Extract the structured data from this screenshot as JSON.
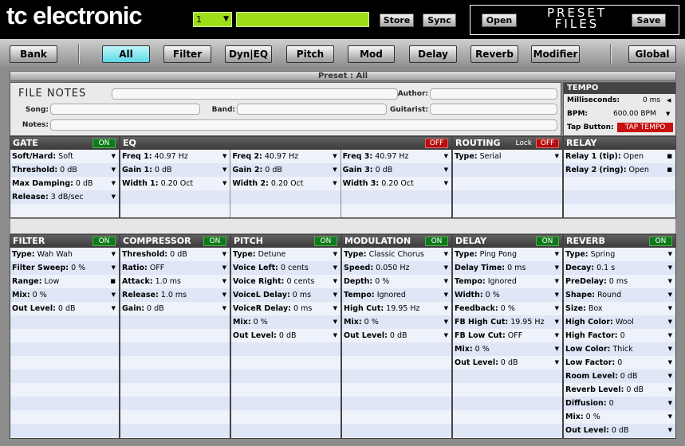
{
  "brand": {
    "name": "tc electronic"
  },
  "top": {
    "preset_number": "1",
    "store": "Store",
    "sync": "Sync",
    "open": "Open",
    "save": "Save",
    "preset_files_line1": "PRESET",
    "preset_files_line2": "FILES"
  },
  "nav": {
    "items": [
      "Bank",
      "All",
      "Filter",
      "Dyn|EQ",
      "Pitch",
      "Mod",
      "Delay",
      "Reverb",
      "Modifier",
      "Global"
    ],
    "active": "All"
  },
  "preset_bar": "Preset : All",
  "notes": {
    "title": "FILE NOTES",
    "song": "Song:",
    "band": "Band:",
    "author": "Author:",
    "guitarist": "Guitarist:",
    "notes": "Notes:"
  },
  "tempo": {
    "title": "TEMPO",
    "ms_label": "Milliseconds:",
    "ms_value": "0 ms",
    "bpm_label": "BPM:",
    "bpm_value": "600.00 BPM",
    "tap_label": "Tap Button:",
    "tap_value": "TAP TEMPO"
  },
  "gate": {
    "title": "GATE",
    "state": "ON",
    "rows": [
      [
        "Soft/Hard:",
        "Soft"
      ],
      [
        "Threshold:",
        "0 dB"
      ],
      [
        "Max Damping:",
        "0 dB"
      ],
      [
        "Release:",
        "3 dB/sec"
      ]
    ]
  },
  "eq": {
    "title": "EQ",
    "state": "OFF",
    "cols": [
      [
        [
          "Freq 1:",
          "40.97 Hz"
        ],
        [
          "Gain 1:",
          "0 dB"
        ],
        [
          "Width 1:",
          "0.20 Oct"
        ]
      ],
      [
        [
          "Freq 2:",
          "40.97 Hz"
        ],
        [
          "Gain 2:",
          "0 dB"
        ],
        [
          "Width 2:",
          "0.20 Oct"
        ]
      ],
      [
        [
          "Freq 3:",
          "40.97 Hz"
        ],
        [
          "Gain 3:",
          "0 dB"
        ],
        [
          "Width 3:",
          "0.20 Oct"
        ]
      ]
    ]
  },
  "routing": {
    "title": "ROUTING",
    "lock": "Lock",
    "state": "OFF",
    "rows": [
      [
        "Type:",
        "Serial"
      ]
    ]
  },
  "relay": {
    "title": "RELAY",
    "rows": [
      [
        "Relay 1 (tip):",
        "Open"
      ],
      [
        "Relay 2 (ring):",
        "Open"
      ]
    ]
  },
  "filter": {
    "title": "FILTER",
    "state": "ON",
    "rows": [
      [
        "Type:",
        "Wah Wah"
      ],
      [
        "Filter Sweep:",
        "0 %"
      ],
      [
        "Range:",
        "Low"
      ],
      [
        "Mix:",
        "0 %"
      ],
      [
        "Out Level:",
        "0 dB"
      ]
    ]
  },
  "compressor": {
    "title": "COMPRESSOR",
    "state": "ON",
    "rows": [
      [
        "Threshold:",
        "0 dB"
      ],
      [
        "Ratio:",
        "OFF"
      ],
      [
        "Attack:",
        "1.0 ms"
      ],
      [
        "Release:",
        "1.0 ms"
      ],
      [
        "Gain:",
        "0 dB"
      ]
    ]
  },
  "pitch": {
    "title": "PITCH",
    "state": "ON",
    "rows": [
      [
        "Type:",
        "Detune"
      ],
      [
        "Voice Left:",
        "0 cents"
      ],
      [
        "Voice Right:",
        "0 cents"
      ],
      [
        "VoiceL Delay:",
        "0 ms"
      ],
      [
        "VoiceR Delay:",
        "0 ms"
      ],
      [
        "Mix:",
        "0 %"
      ],
      [
        "Out Level:",
        "0 dB"
      ]
    ]
  },
  "modulation": {
    "title": "MODULATION",
    "state": "ON",
    "rows": [
      [
        "Type:",
        "Classic Chorus"
      ],
      [
        "Speed:",
        "0.050 Hz"
      ],
      [
        "Depth:",
        "0 %"
      ],
      [
        "Tempo:",
        "Ignored"
      ],
      [
        "High Cut:",
        "19.95 Hz"
      ],
      [
        "Mix:",
        "0 %"
      ],
      [
        "Out Level:",
        "0 dB"
      ]
    ]
  },
  "delay": {
    "title": "DELAY",
    "state": "ON",
    "rows": [
      [
        "Type:",
        "Ping Pong"
      ],
      [
        "Delay Time:",
        "0 ms"
      ],
      [
        "Tempo:",
        "Ignored"
      ],
      [
        "Width:",
        "0 %"
      ],
      [
        "Feedback:",
        "0 %"
      ],
      [
        "FB High Cut:",
        "19.95 Hz"
      ],
      [
        "FB Low Cut:",
        "OFF"
      ],
      [
        "Mix:",
        "0 %"
      ],
      [
        "Out Level:",
        "0 dB"
      ]
    ]
  },
  "reverb": {
    "title": "REVERB",
    "state": "ON",
    "rows": [
      [
        "Type:",
        "Spring"
      ],
      [
        "Decay:",
        "0.1 s"
      ],
      [
        "PreDelay:",
        "0 ms"
      ],
      [
        "Shape:",
        "Round"
      ],
      [
        "Size:",
        "Box"
      ],
      [
        "High Color:",
        "Wool"
      ],
      [
        "High Factor:",
        "0"
      ],
      [
        "Low Color:",
        "Thick"
      ],
      [
        "Low Factor:",
        "0"
      ],
      [
        "Room Level:",
        "0 dB"
      ],
      [
        "Reverb Level:",
        "0 dB"
      ],
      [
        "Diffusion:",
        "0"
      ],
      [
        "Mix:",
        "0 %"
      ],
      [
        "Out Level:",
        "0 dB"
      ]
    ]
  }
}
